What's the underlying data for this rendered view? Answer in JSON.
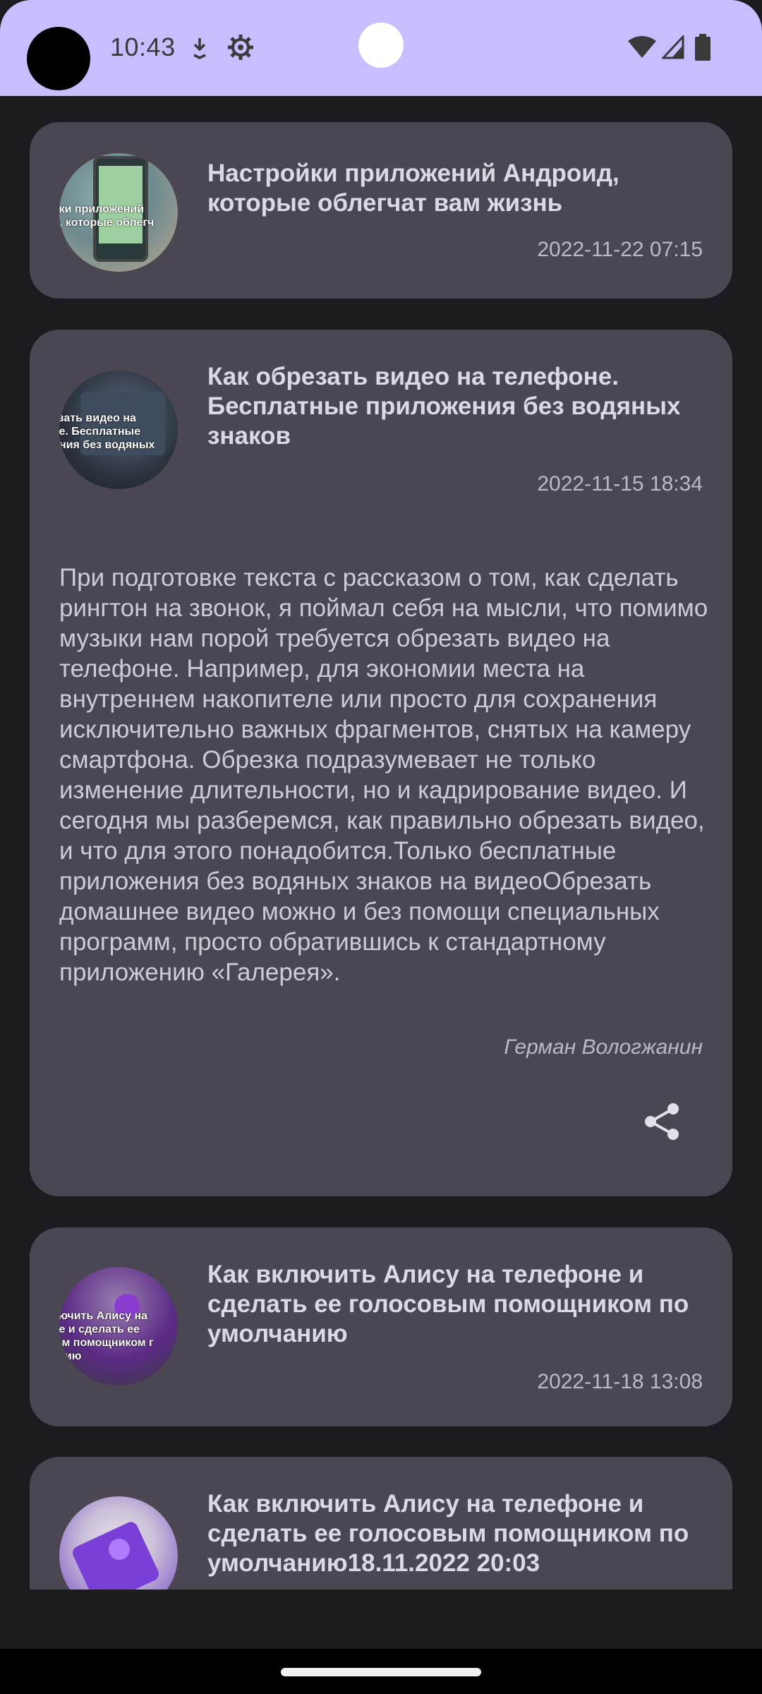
{
  "status_bar": {
    "time": "10:43",
    "left_icons": [
      "download-icon",
      "settings-gear-icon"
    ],
    "right_icons": [
      "wifi-icon",
      "signal-icon",
      "battery-icon"
    ]
  },
  "articles": [
    {
      "title": "Настройки приложений Андроид, которые облегчат вам жизнь",
      "date": "2022-11-22 07:15",
      "thumb_caption": "ойки приложений\nид, которые облегч\nзнь",
      "thumb_colors": [
        "#6d8a8f",
        "#b8a88f"
      ]
    },
    {
      "title": "Как обрезать видео на телефоне. Бесплатные приложения без водяных знаков",
      "date": "2022-11-15 18:34",
      "thumb_caption": "резать видео на\nоне. Бесплатные\nжения без водяных",
      "thumb_colors": [
        "#2d3440",
        "#5a6a80"
      ],
      "body": "При подготовке текста с рассказом о том, как сделать рингтон на звонок, я поймал себя на мысли, что помимо музыки нам порой требуется обрезать видео на телефоне. Например, для экономии места на внутреннем накопителе или просто для сохранения исключительно важных фрагментов, снятых на камеру смартфона. Обрезка подразумевает не только изменение длительности, но и кадрирование видео. И сегодня мы разберемся, как правильно обрезать видео, и что для этого понадобится.Только бесплатные приложения без водяных знаков на видеоОбрезать домашнее видео можно и без помощи специальных программ, просто обратившись к стандартному приложению «Галерея».",
      "author": "Герман Вологжанин",
      "share_icon": "share-icon"
    },
    {
      "title": "Как включить Алису на телефоне и сделать ее голосовым помощником по умолчанию",
      "date": "2022-11-18 13:08",
      "thumb_caption": "ключить Алису на\nоне и сделать ее\nвым помощником г\nчанию",
      "thumb_colors": [
        "#5b2a86",
        "#9a7fb0"
      ]
    },
    {
      "title": "Как включить Алису на телефоне и сделать ее голосовым помощником по умолчанию18.11.2022 20:03",
      "thumb_caption": "",
      "thumb_colors": [
        "#e9e4ef",
        "#6c3fc4"
      ]
    }
  ]
}
